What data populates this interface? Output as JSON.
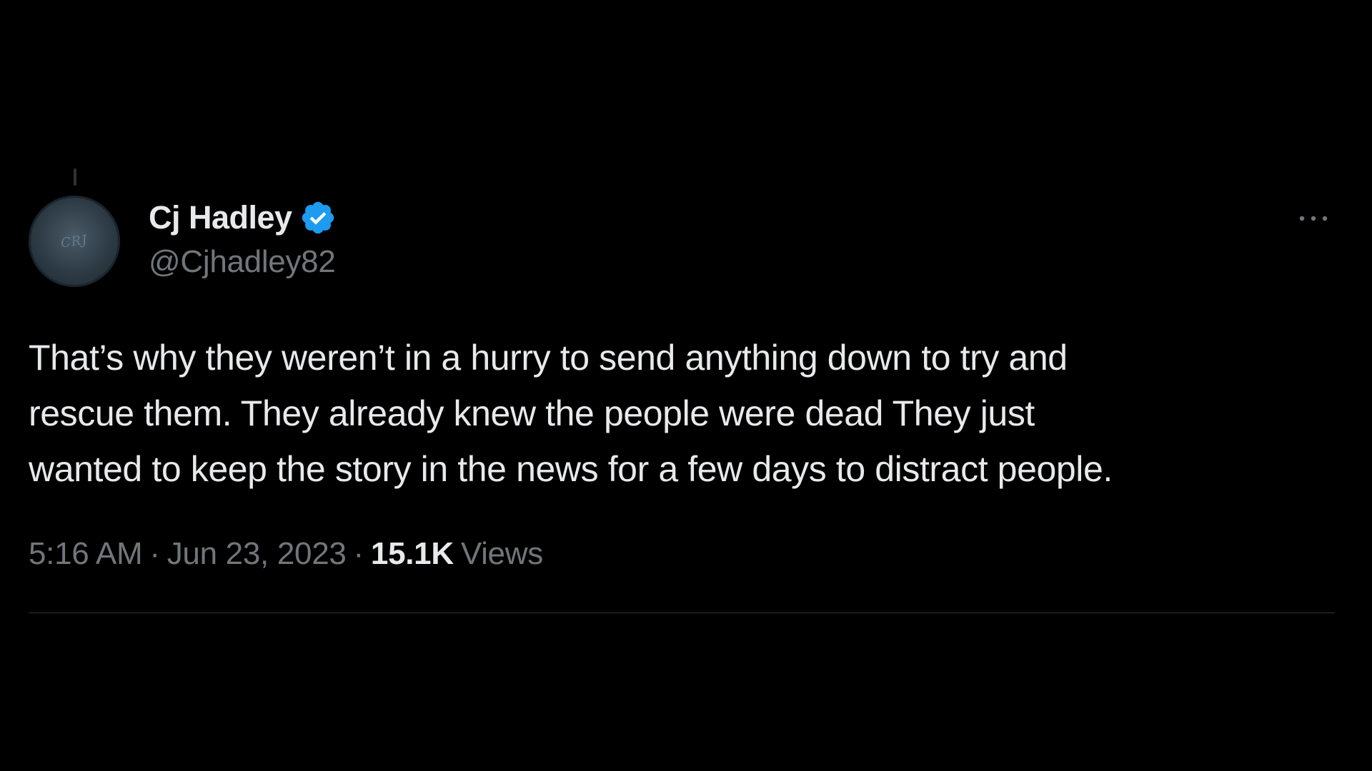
{
  "tweet": {
    "author": {
      "display_name": "Cj Hadley",
      "handle": "@Cjhadley82",
      "verified": true,
      "avatar_mark": "CRJ"
    },
    "more_icon": "ellipsis-icon",
    "text": "That’s why they weren’t in a hurry to send anything down to try and\nrescue them. They already knew the people were dead   They just\nwanted to keep the story in the news for a few days to distract people.",
    "time": "5:16 AM",
    "separator": "·",
    "date": "Jun 23, 2023",
    "views_count": "15.1K",
    "views_label": "Views"
  },
  "colors": {
    "background": "#000000",
    "primary_text": "#e7e9ea",
    "secondary_text": "#71767b",
    "verified_blue": "#1d9bf0",
    "divider": "#2f3336"
  }
}
